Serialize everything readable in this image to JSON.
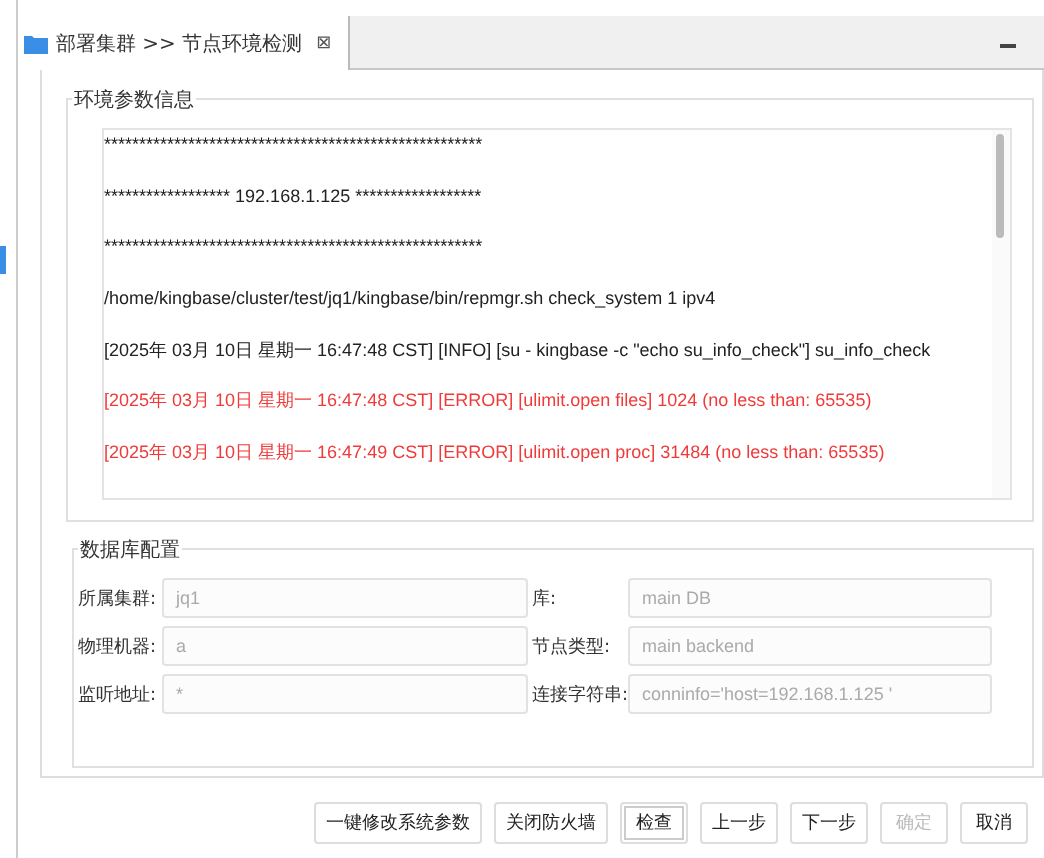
{
  "tab": {
    "title": "部署集群 >> 节点环境检测",
    "close": "⊠",
    "selected": true
  },
  "env_group": {
    "title": "环境参数信息",
    "log": [
      {
        "text": "******************************************************",
        "kind": "normal"
      },
      {
        "text": "****************** 192.168.1.125 ******************",
        "kind": "normal"
      },
      {
        "text": "******************************************************",
        "kind": "normal"
      },
      {
        "text": "/home/kingbase/cluster/test/jq1/kingbase/bin/repmgr.sh check_system 1 ipv4",
        "kind": "normal"
      },
      {
        "text": "[2025年 03月 10日 星期一 16:47:48 CST] [INFO] [su - kingbase -c \"echo su_info_check\"] su_info_check",
        "kind": "normal"
      },
      {
        "text": "[2025年 03月 10日 星期一 16:47:48 CST] [ERROR] [ulimit.open files] 1024 (no less than: 65535)",
        "kind": "error"
      },
      {
        "text": "[2025年 03月 10日 星期一 16:47:49 CST] [ERROR] [ulimit.open proc] 31484 (no less than: 65535)",
        "kind": "error"
      }
    ]
  },
  "db_group": {
    "title": "数据库配置",
    "fields": [
      {
        "label": "所属集群:",
        "value": "jq1",
        "disabled": true
      },
      {
        "label": "库:",
        "value": "main DB",
        "disabled": true
      },
      {
        "label": "物理机器:",
        "value": "a",
        "disabled": true
      },
      {
        "label": "节点类型:",
        "value": "main backend",
        "disabled": true
      },
      {
        "label": "监听地址:",
        "value": "*",
        "disabled": true
      },
      {
        "label": "连接字符串:",
        "value": "conninfo='host=192.168.1.125 '",
        "disabled": true
      }
    ]
  },
  "buttons": [
    {
      "label": "一键修改系统参数",
      "disabled": false,
      "selected": false
    },
    {
      "label": "关闭防火墙",
      "disabled": false,
      "selected": false
    },
    {
      "label": "检查",
      "disabled": false,
      "selected": true
    },
    {
      "label": "上一步",
      "disabled": false,
      "selected": false
    },
    {
      "label": "下一步",
      "disabled": false,
      "selected": false
    },
    {
      "label": "确定",
      "disabled": true,
      "selected": false
    },
    {
      "label": "取消",
      "disabled": false,
      "selected": false
    }
  ]
}
